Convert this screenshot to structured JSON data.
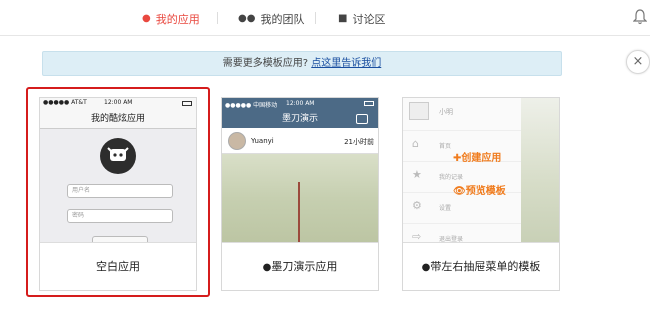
{
  "nav": {
    "items": [
      {
        "label": "我的应用",
        "icon": "user-icon",
        "active": true
      },
      {
        "label": "我的团队",
        "icon": "users-icon",
        "active": false
      },
      {
        "label": "讨论区",
        "icon": "chat-icon",
        "active": false
      }
    ]
  },
  "notice": {
    "text": "需要更多模板应用?",
    "link": "点这里告诉我们"
  },
  "close_glyph": "×",
  "cards": [
    {
      "caption": "空白应用",
      "selected": true,
      "preview": {
        "carrier": "●●●●● AT&T",
        "time": "12:00 AM",
        "title": "我的酷炫应用",
        "username_placeholder": "用户名",
        "password_placeholder": "密码"
      }
    },
    {
      "caption": "墨刀演示应用",
      "selected": false,
      "preview": {
        "carrier": "●●●●● 中国移动",
        "time": "12:00 AM",
        "title": "墨刀演示",
        "user": "Yuanyi",
        "posted": "21小时前"
      }
    },
    {
      "caption": "带左右抽屉菜单的模板",
      "selected": false,
      "preview": {
        "name": "小明",
        "menu": [
          "首页",
          "我的记录",
          "设置",
          "退出登录"
        ],
        "overlay_create": "✚创建应用",
        "overlay_preview": "👁预览模板"
      }
    }
  ],
  "colors": {
    "accent": "#e9483f",
    "selection": "#d51c1c",
    "notice_bg": "#ddeef6",
    "link": "#1a4fa0",
    "demo_header": "#4c6a86",
    "overlay_label": "#f07c1e"
  }
}
